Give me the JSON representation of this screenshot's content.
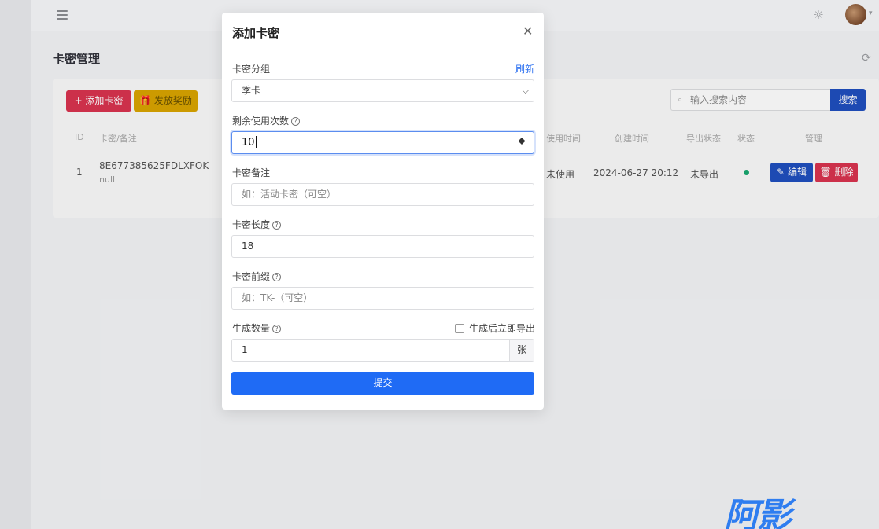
{
  "background": {
    "page_title": "卡密管理",
    "toolbar": {
      "add_label": "+ 添加卡密",
      "gift_label": "🎁 发放奖励",
      "search_placeholder": "输入搜索内容",
      "search_button": "搜索"
    },
    "table": {
      "headers": [
        "ID",
        "卡密/备注",
        "使用时间",
        "创建时间",
        "导出状态",
        "状态",
        "管理"
      ],
      "rows": [
        {
          "id": "1",
          "card": "8E677385625FDLXFOK",
          "note": "null",
          "used": "未使用",
          "created": "2024-06-27 20:12",
          "export_status": "未导出",
          "status_color": "#1aa870",
          "edit_label": "编辑",
          "delete_label": "删除"
        }
      ]
    }
  },
  "modal": {
    "title": "添加卡密",
    "close_icon": "close-icon",
    "group_label": "卡密分组",
    "refresh_link": "刷新",
    "group_value": "季卡",
    "uses_label": "剩余使用次数",
    "uses_value": "10",
    "note_label": "卡密备注",
    "note_placeholder": "如：活动卡密（可空）",
    "length_label": "卡密长度",
    "length_value": "18",
    "prefix_label": "卡密前缀",
    "prefix_placeholder": "如：TK-（可空）",
    "count_label": "生成数量",
    "export_checkbox_label": "生成后立即导出",
    "count_value": "1",
    "count_unit": "张",
    "submit_label": "提交"
  },
  "watermark": "阿影",
  "colors": {
    "primary": "#1f6bf5",
    "danger": "#d9334f",
    "warning": "#d9a400",
    "link": "#2a6ff0"
  }
}
